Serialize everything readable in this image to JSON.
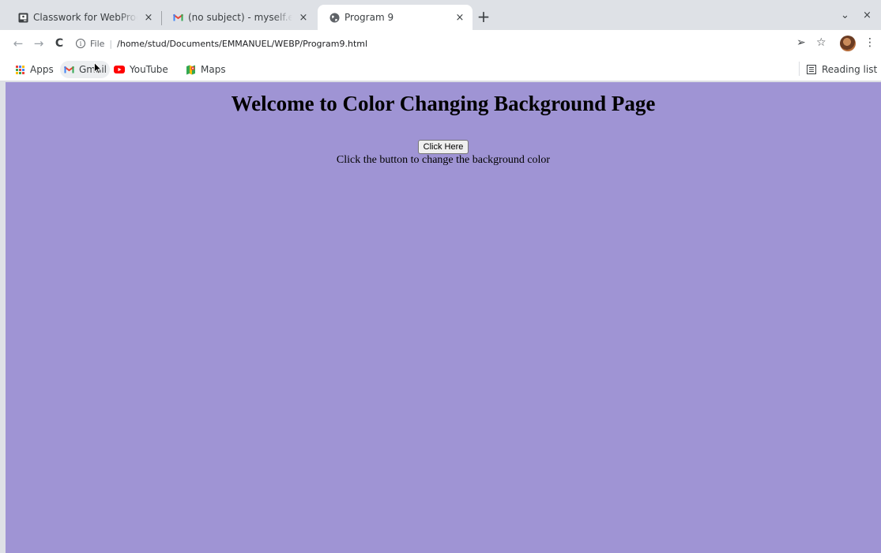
{
  "tabs": [
    {
      "title": "Classwork for WebProgramming",
      "close": "×",
      "icon": "classroom-icon"
    },
    {
      "title": "(no subject) - myself.emmanuel",
      "close": "×",
      "icon": "gmail-icon"
    },
    {
      "title": "Program 9",
      "close": "×",
      "icon": "globe-icon"
    }
  ],
  "new_tab": "+",
  "window_controls": {
    "menu": "⌄",
    "close": "×"
  },
  "toolbar": {
    "back": "←",
    "forward": "→",
    "reload": "C",
    "scheme": "File",
    "url": "/home/stud/Documents/EMMANUEL/WEBP/Program9.html",
    "share": "➢",
    "star": "☆",
    "menu": "⋮"
  },
  "bookmarks": [
    {
      "label": "Apps",
      "icon": "apps-grid-icon"
    },
    {
      "label": "Gmail",
      "icon": "gmail-icon"
    },
    {
      "label": "YouTube",
      "icon": "youtube-icon"
    },
    {
      "label": "Maps",
      "icon": "maps-icon"
    }
  ],
  "reading_list": "Reading list",
  "page": {
    "heading": "Welcome to Color Changing Background Page",
    "button_label": "Click Here",
    "instruction": "Click the button to change the background color",
    "background_color": "#9f94d4"
  }
}
